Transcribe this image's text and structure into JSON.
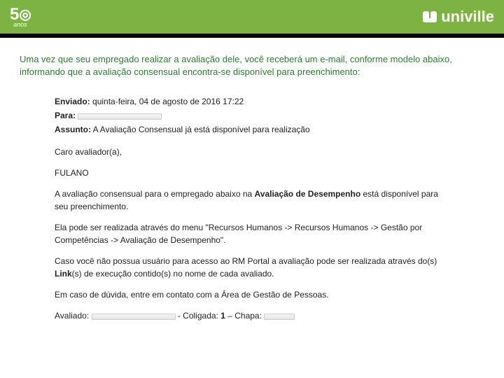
{
  "header": {
    "logo50_top": "5",
    "logo50_swirl": "◎",
    "logo50_bottom": "anos",
    "univille_label": "univille"
  },
  "intro": "Uma vez que seu empregado realizar a avaliação dele, você receberá um e-mail, conforme modelo abaixo, informando que a avaliação consensual encontra-se disponível para preenchimento:",
  "email": {
    "enviado_label": "Enviado:",
    "enviado_value": "quinta-feira, 04 de agosto de 2016 17:22",
    "para_label": "Para:",
    "assunto_label": "Assunto:",
    "assunto_value": "A Avaliação Consensual já está disponível para realização",
    "salutation": "Caro avaliador(a),",
    "name": "FULANO",
    "p1_a": "A avaliação consensual para o empregado abaixo na ",
    "p1_b_bold": "Avaliação de Desempenho",
    "p1_c": " está disponível para seu preenchimento.",
    "p2": "Ela pode ser realizada através do menu \"Recursos Humanos -> Recursos Humanos -> Gestão por Competências -> Avaliação de Desempenho\".",
    "p3_a": "Caso você não possua usuário para acesso ao RM Portal a avaliação pode ser realizada através do(s) ",
    "p3_b_bold": "Link",
    "p3_c": "(s) de execução contido(s) no nome de cada avaliado.",
    "p4": "Em caso de dúvida, entre em contato com a Área de Gestão de Pessoas.",
    "avaliado_label": "Avaliado:",
    "coligada_label": " - Coligada: ",
    "coligada_value": "1",
    "chapa_label": " – Chapa: "
  }
}
